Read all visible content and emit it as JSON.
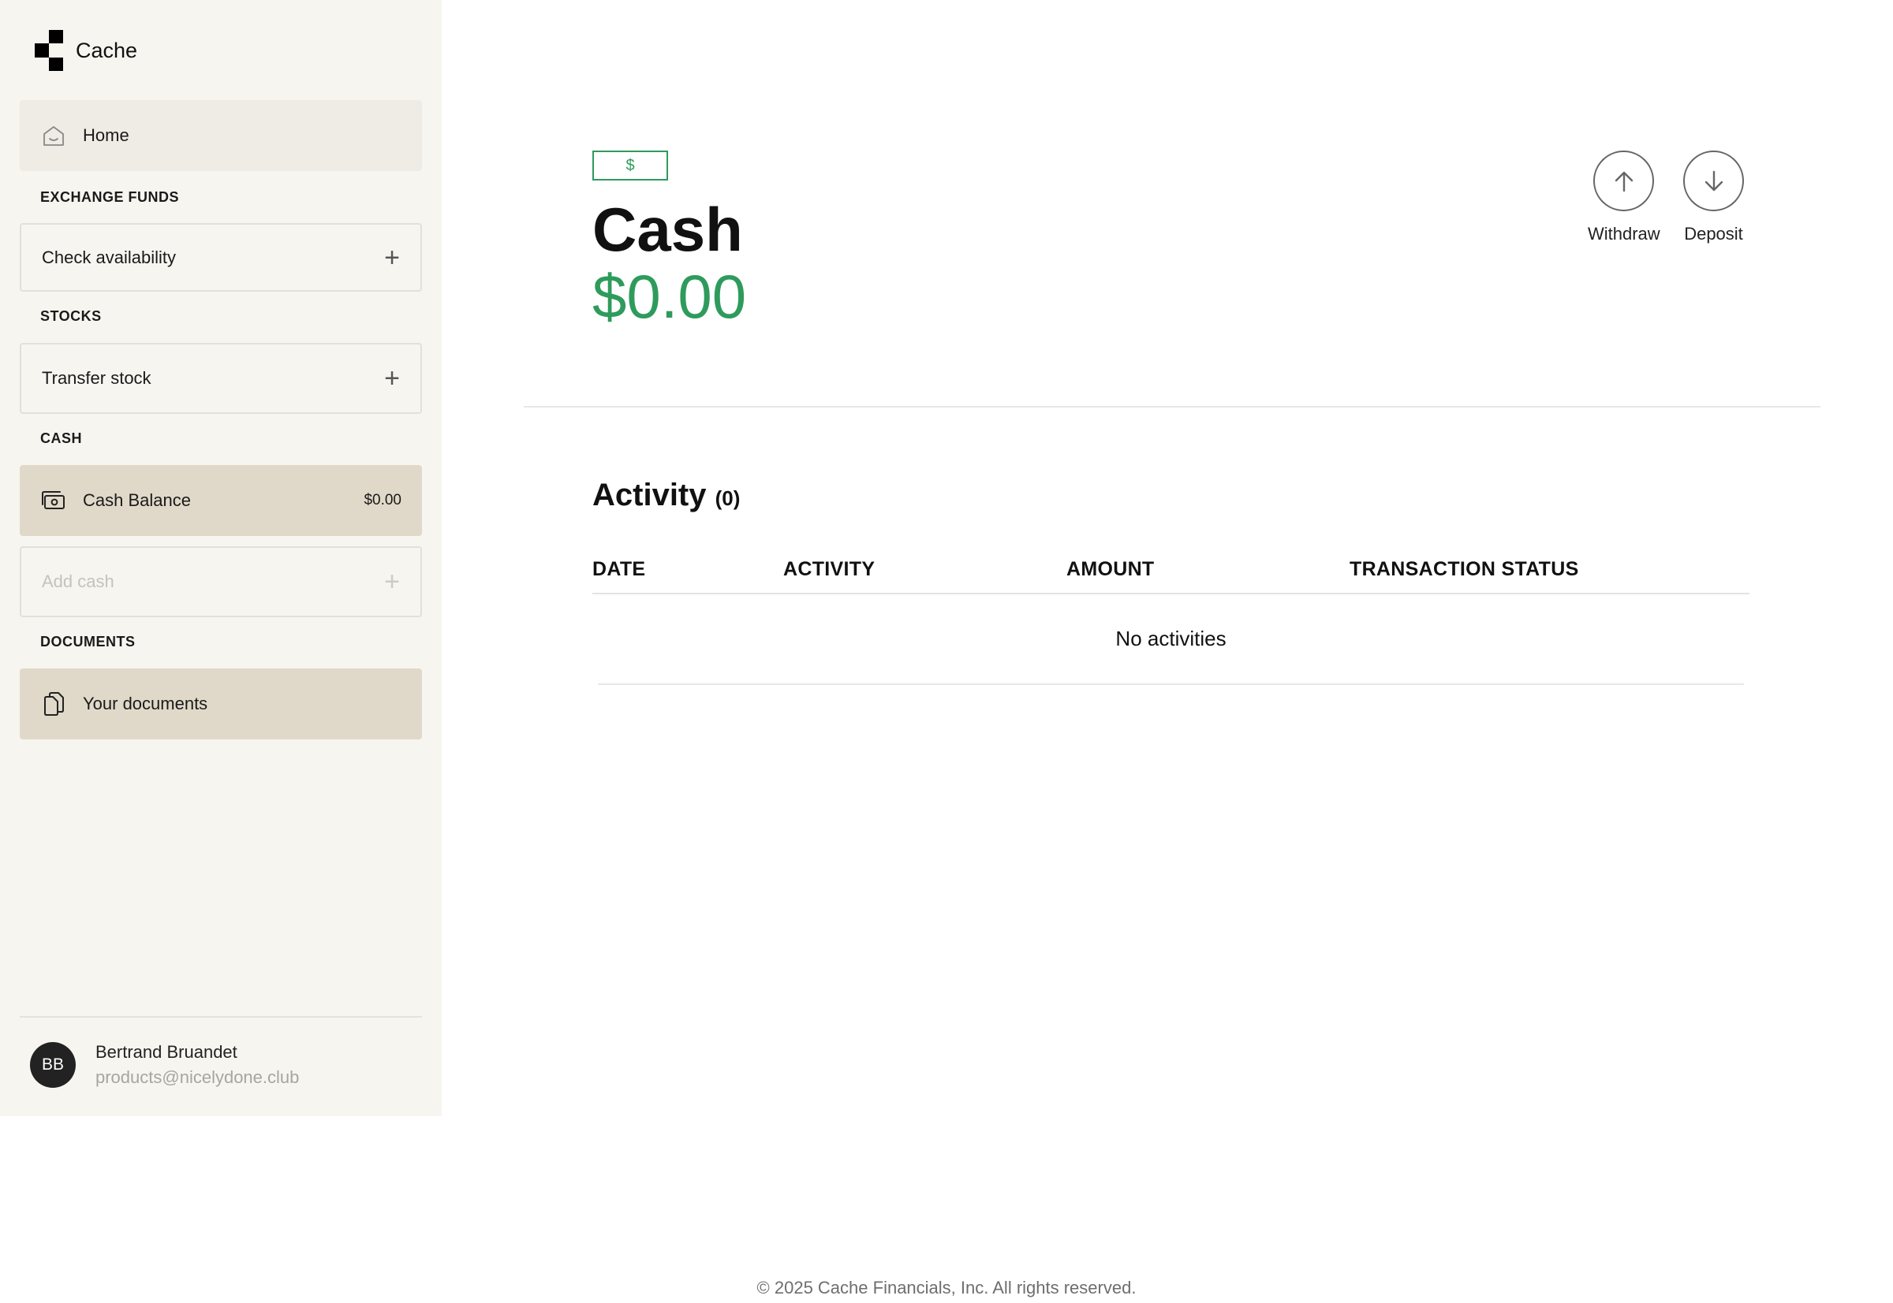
{
  "brand": {
    "name": "Cache"
  },
  "sidebar": {
    "home": {
      "label": "Home",
      "icon": "home-icon"
    },
    "sections": {
      "exchange_funds": "EXCHANGE FUNDS",
      "stocks": "STOCKS",
      "cash": "CASH",
      "documents": "DOCUMENTS"
    },
    "check_availability": {
      "label": "Check availability",
      "action_icon": "+"
    },
    "transfer_stock": {
      "label": "Transfer stock",
      "action_icon": "+"
    },
    "cash_balance": {
      "label": "Cash Balance",
      "value": "$0.00",
      "icon": "cash-icon"
    },
    "add_cash": {
      "label": "Add cash",
      "action_icon": "+"
    },
    "your_documents": {
      "label": "Your documents",
      "icon": "documents-icon"
    }
  },
  "profile": {
    "initials": "BB",
    "name": "Bertrand Bruandet",
    "email": "products@nicelydone.club"
  },
  "main": {
    "currency_badge": "$",
    "title": "Cash",
    "balance": "$0.00",
    "actions": {
      "withdraw": "Withdraw",
      "deposit": "Deposit"
    },
    "activity": {
      "title": "Activity",
      "count": "(0)",
      "columns": [
        "DATE",
        "ACTIVITY",
        "AMOUNT",
        "TRANSACTION STATUS"
      ],
      "empty_text": "No activities"
    }
  },
  "footer": {
    "text": "© 2025 Cache Financials, Inc. All rights reserved."
  },
  "colors": {
    "accent_green": "#2e9b5c",
    "sidebar_bg": "#f7f5f0",
    "selected_item_bg": "#e0d9c9"
  }
}
